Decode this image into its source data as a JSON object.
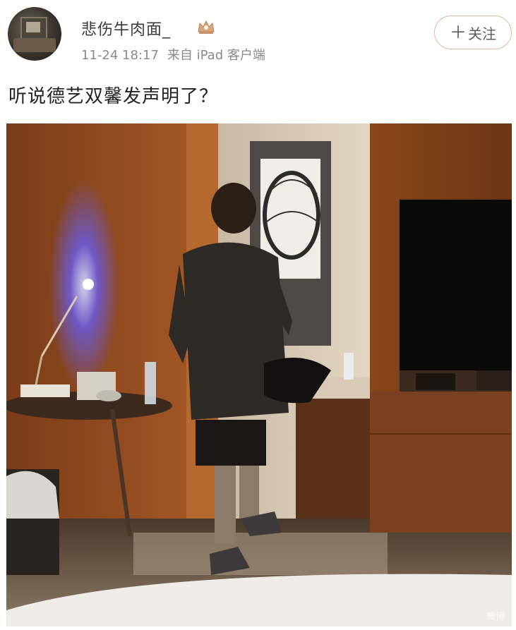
{
  "post": {
    "username": "悲伤牛肉面_",
    "vip_icon": "crown-badge-icon",
    "timestamp": "11-24 18:17",
    "source": "来自 iPad 客户端",
    "follow_label": "关注",
    "text": "听说德艺双馨发声明了？"
  },
  "photo": {
    "watermark": "微博"
  },
  "colors": {
    "follow_border": "#ddb9a3",
    "meta_text": "#8a8a8a",
    "username_text": "#3b3b3b"
  }
}
